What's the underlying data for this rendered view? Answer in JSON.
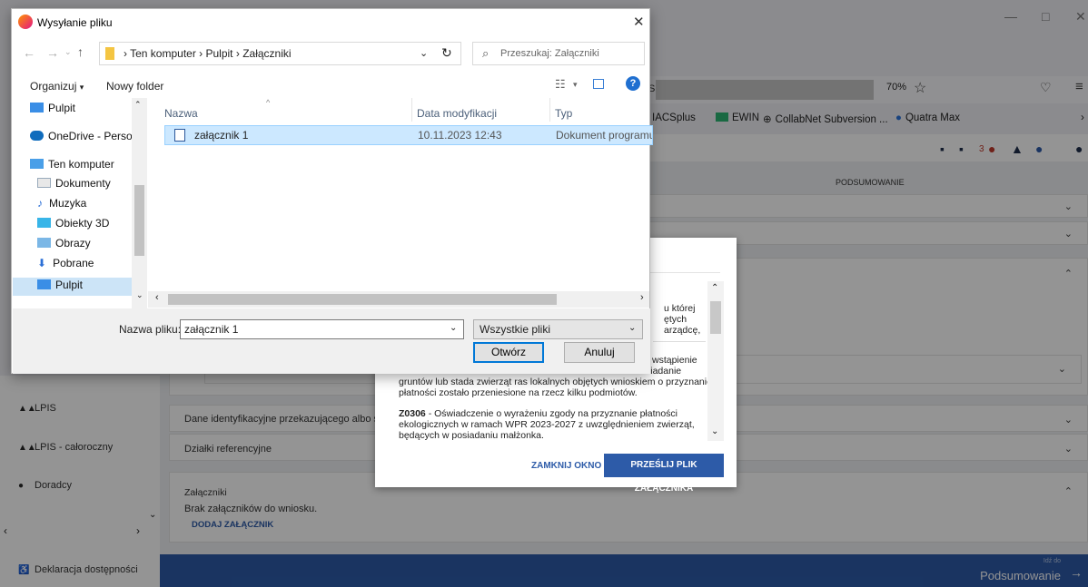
{
  "browser": {
    "zoom": "70%",
    "bookmarks": [
      "IACSplus",
      "EWIN",
      "CollabNet Subversion ...",
      "Quatra Max"
    ],
    "notification_count": "3"
  },
  "app": {
    "summary_header": "PODSUMOWANIE",
    "sidebar_items": [
      "LPIS",
      "LPIS - całoroczny",
      "Doradcy",
      "Deklaracja dostępności"
    ],
    "cards": {
      "transferor": "Dane identyfikacyjne przekazującego albo spad",
      "parcels": "Działki referencyjne",
      "attachments_title": "Załączniki",
      "attachments_empty": "Brak załączników do wniosku.",
      "add_attachment": "DODAJ ZAŁĄCZNIK"
    },
    "bottom": {
      "small": "Idź do",
      "big": "Podsumowanie"
    }
  },
  "modal": {
    "frag1": "u której",
    "frag2": "ętych",
    "frag3": "arządcę,",
    "frag4": "wstąpienie",
    "frag5": "siadanie",
    "para1_line1": "gruntów lub stada zwierząt ras lokalnych objętych wnioskiem o przyznanie",
    "para1_line2": "płatności zostało przeniesione na rzecz kilku podmiotów.",
    "para2_code": "Z0306",
    "para2_line1": " - Oświadczenie o wyrażeniu zgody na przyznanie płatności",
    "para2_line2": "ekologicznych w ramach WPR 2023-2027 z uwzględnieniem zwierząt,",
    "para2_line3": "będących w posiadaniu małżonka.",
    "close_label": "ZAMKNIJ OKNO",
    "send_label": "PRZEŚLIJ PLIK ZAŁĄCZNIKA"
  },
  "dialog": {
    "title": "Wysyłanie pliku",
    "breadcrumb": [
      "Ten komputer",
      "Pulpit",
      "Załączniki"
    ],
    "search_placeholder": "Przeszukaj: Załączniki",
    "organize": "Organizuj",
    "new_folder": "Nowy folder",
    "nav_items": [
      "Pulpit",
      "OneDrive - Person",
      "Ten komputer",
      "Dokumenty",
      "Muzyka",
      "Obiekty 3D",
      "Obrazy",
      "Pobrane",
      "Pulpit"
    ],
    "columns": [
      "Nazwa",
      "Data modyfikacji",
      "Typ"
    ],
    "files": [
      {
        "name": "załącznik 1",
        "modified": "10.11.2023 12:43",
        "type": "Dokument programu"
      }
    ],
    "filename_label": "Nazwa pliku:",
    "filename_value": "załącznik 1",
    "filter_value": "Wszystkie pliki",
    "open_label": "Otwórz",
    "cancel_label": "Anuluj"
  }
}
